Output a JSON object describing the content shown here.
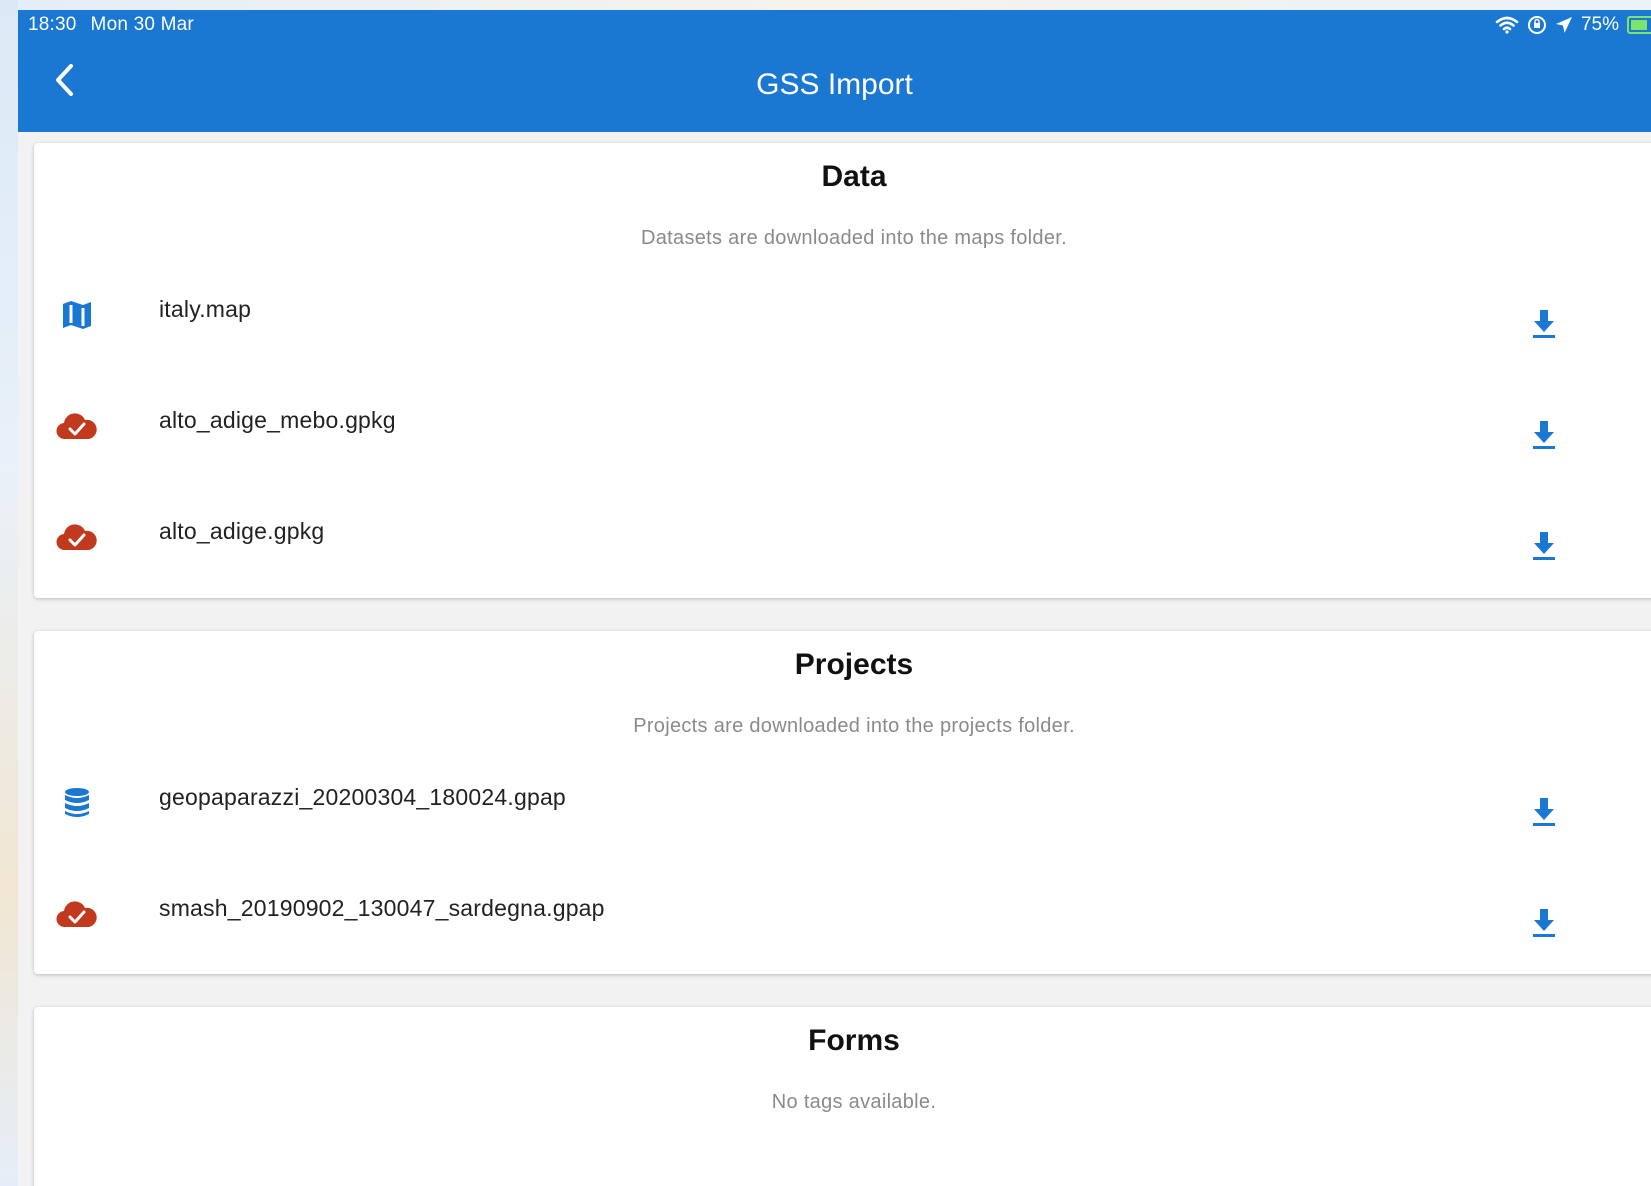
{
  "status_bar": {
    "time": "18:30",
    "date": "Mon 30 Mar",
    "battery": "75%"
  },
  "app_bar": {
    "title": "GSS Import"
  },
  "colors": {
    "primary": "#1a77d2",
    "cloud_red": "#c23a1e",
    "subtitle_gray": "#8a8a8a"
  },
  "sections": {
    "data": {
      "title": "Data",
      "subtitle": "Datasets are downloaded into the maps folder.",
      "items": [
        {
          "name": "italy.map",
          "icon": "map-icon"
        },
        {
          "name": "alto_adige_mebo.gpkg",
          "icon": "cloud-check-icon"
        },
        {
          "name": "alto_adige.gpkg",
          "icon": "cloud-check-icon"
        }
      ]
    },
    "projects": {
      "title": "Projects",
      "subtitle": "Projects are downloaded into the projects folder.",
      "items": [
        {
          "name": "geopaparazzi_20200304_180024.gpap",
          "icon": "database-icon"
        },
        {
          "name": "smash_20190902_130047_sardegna.gpap",
          "icon": "cloud-check-icon"
        }
      ]
    },
    "forms": {
      "title": "Forms",
      "subtitle": "No tags available."
    }
  }
}
